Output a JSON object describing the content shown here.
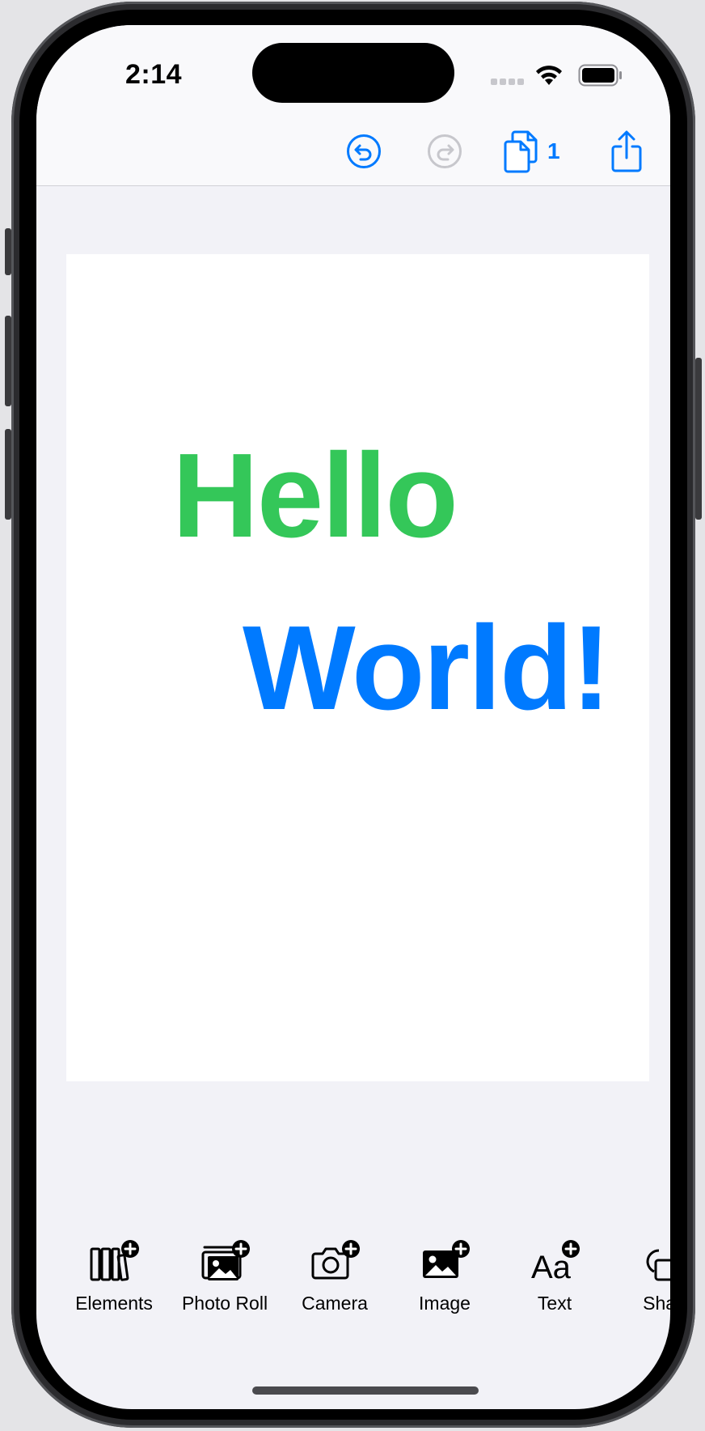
{
  "status_bar": {
    "time": "2:14"
  },
  "toolbar": {
    "undo_icon": "undo-arrow-circle-icon",
    "redo_icon": "redo-arrow-circle-icon",
    "pages_icon": "documents-icon",
    "page_count": "1",
    "share_icon": "share-up-arrow-icon",
    "accent_color": "#007aff",
    "disabled_color": "#c7c7cc"
  },
  "canvas": {
    "text_1": "Hello",
    "text_1_color": "#34c759",
    "text_2": "World!",
    "text_2_color": "#007aff"
  },
  "dock": {
    "items": [
      {
        "label": "Elements",
        "icon": "elements-add-icon"
      },
      {
        "label": "Photo Roll",
        "icon": "photo-roll-add-icon"
      },
      {
        "label": "Camera",
        "icon": "camera-add-icon"
      },
      {
        "label": "Image",
        "icon": "image-add-icon"
      },
      {
        "label": "Text",
        "icon": "text-add-icon"
      },
      {
        "label": "Shap",
        "icon": "shape-add-icon"
      }
    ]
  }
}
